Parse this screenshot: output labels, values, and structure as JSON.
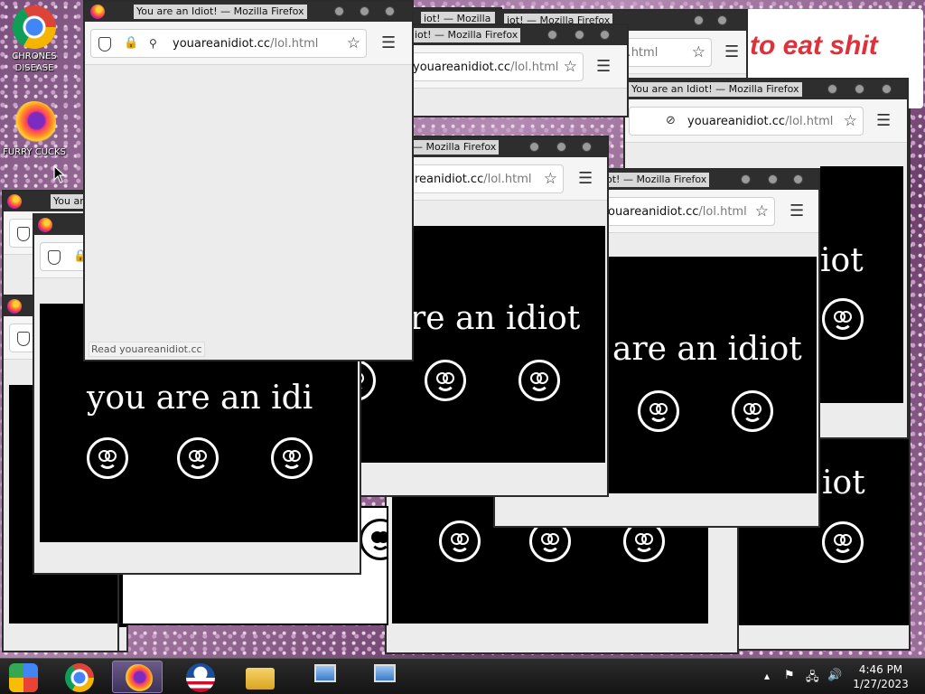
{
  "desktop": {
    "icons": [
      {
        "label": "CHRONES DISEASE",
        "icon": "chrome-icon"
      },
      {
        "label": "FURRY CUCKS",
        "icon": "firefox-icon"
      }
    ],
    "billboard_text": "to eat shit"
  },
  "window_title": "You are an Idiot! — Mozilla Firefox",
  "title_fragments": {
    "t1": "You are an Idiot! — Mozilla Firefox",
    "t2": "iot! — Mozilla Firefox",
    "t3": "Mozilla Firefox",
    "t4": "You are an Idiot! — Mozilla Firefox",
    "t5": "— Mozilla Firefox",
    "t6": "ot! — Mozilla Firefox",
    "t7": "You ar"
  },
  "url": {
    "host": "youareanidiot.cc",
    "path": "/lol.html",
    "host_partial_a": "youareanidiot.cc",
    "host_partial_b": "reanidiot.cc",
    "host_partial_c": "ouareanidiot.cc",
    "host_partial_d": "iot.cc"
  },
  "page_message": "you are an idiot",
  "message_fragments": {
    "m1": "you are an idi",
    "m2": "re an idiot",
    "m3": "are an idiot",
    "m4": "iot",
    "m5": "iot"
  },
  "status_text": "Read youareanidiot.cc",
  "taskbar": {
    "apps": [
      "chrome-os-icon",
      "chrome-icon",
      "firefox-icon",
      "obama-logo-icon",
      "file-explorer-icon",
      "network-setup-icon",
      "network-setup-icon"
    ],
    "clock_time": "4:46 PM",
    "clock_date": "1/27/2023"
  },
  "colors": {
    "stage_bg": "#000000",
    "stage_fg": "#ffffff",
    "window_frame": "#2e2e2e",
    "billboard_text": "#e0303a"
  }
}
